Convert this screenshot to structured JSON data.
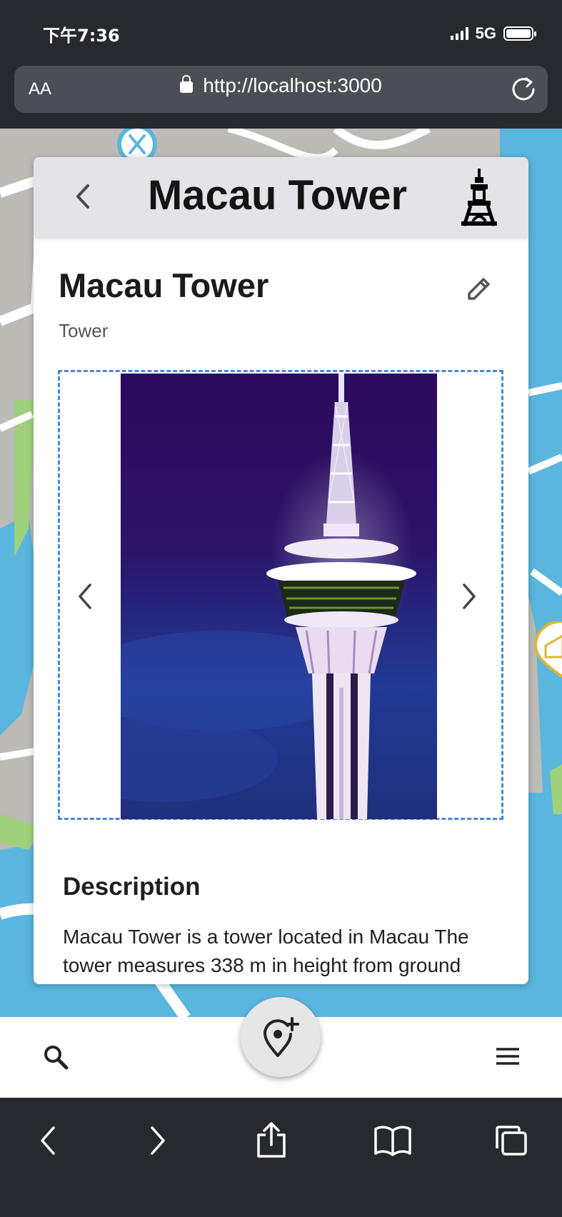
{
  "status": {
    "time": "下午7:36",
    "network": "5G"
  },
  "browser": {
    "text_size_label": "AA",
    "url": "http://localhost:3000"
  },
  "header": {
    "title": "Macau Tower",
    "icon": "tower-icon"
  },
  "place": {
    "name": "Macau Tower",
    "type": "Tower",
    "photo_alt": "Macau Tower at night"
  },
  "description": {
    "title": "Description",
    "text": "Macau Tower is a tower located in Macau The tower measures 338 m in height from ground"
  },
  "colors": {
    "map_land": "#bdbbb6",
    "map_water": "#5ab6de",
    "carousel_border": "#4a86e0",
    "header_bg": "#e4e4e8",
    "chrome_bg": "#26292d"
  },
  "icons": {
    "back": "chevron-left-icon",
    "edit": "pencil-icon",
    "search": "search-icon",
    "menu": "hamburger-icon",
    "add_place": "add-location-icon"
  }
}
